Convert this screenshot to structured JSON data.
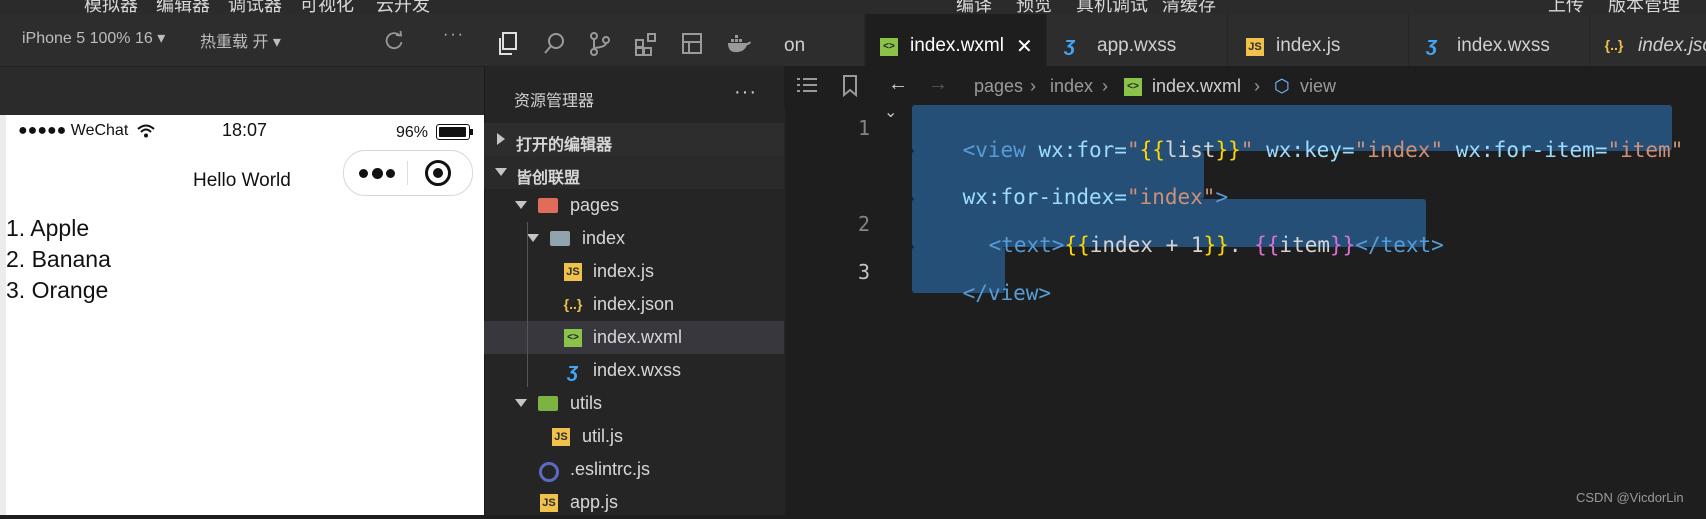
{
  "menu": [
    "模拟器",
    "编辑器",
    "调试器",
    "可视化",
    "云开发",
    "编译",
    "预览",
    "真机调试",
    "清缓存",
    "上传",
    "版本管理"
  ],
  "simulator": {
    "device": "iPhone 5 100% 16",
    "hotreload": "热重载 开",
    "status": {
      "signal": "●●●●● WeChat",
      "time": "18:07",
      "battery": "96%"
    },
    "nav_title": "Hello World",
    "list": [
      "1. Apple",
      "2. Banana",
      "3. Orange"
    ]
  },
  "explorer": {
    "title": "资源管理器",
    "more": "···",
    "open_editors": "打开的编辑器",
    "project": "皆创联盟",
    "files": {
      "pages": "pages",
      "index": "index",
      "index_js": "index.js",
      "index_json": "index.json",
      "index_wxml": "index.wxml",
      "index_wxss": "index.wxss",
      "utils": "utils",
      "util_js": "util.js",
      "eslintrc": ".eslintrc.js",
      "app_js": "app.js"
    }
  },
  "tabs": [
    {
      "label": "on"
    },
    {
      "label": "index.wxml",
      "active": true
    },
    {
      "label": "app.wxss"
    },
    {
      "label": "index.js"
    },
    {
      "label": "index.wxss"
    },
    {
      "label": "index.json"
    }
  ],
  "breadcrumb": [
    "pages",
    "index",
    "index.wxml",
    "view"
  ],
  "code": {
    "line_numbers": [
      "1",
      "2",
      "3"
    ],
    "l1a_open": "<view",
    "l1a_forattr": " wx:for=",
    "l1a_q1": "\"",
    "l1a_brace_open": "{{",
    "l1a_list": "list",
    "l1a_brace_close": "}}",
    "l1a_q2": "\"",
    "l1a_keyattr": " wx:key=",
    "l1a_keyval": "\"index\"",
    "l1a_itemattr": " wx:for-item=",
    "l1a_itemval": "\"item\"",
    "l1b_idxattr": "wx:for-index=",
    "l1b_idxval": "\"index\"",
    "l1b_gt": ">",
    "l2_text_open": "<text>",
    "l2_b1": "{{",
    "l2_expr": "index + 1",
    "l2_b2": "}}",
    "l2_dot": ". ",
    "l2_b3": "{{",
    "l2_item": "item",
    "l2_b4": "}}",
    "l2_text_close": "</text>",
    "l3_close": "</view>"
  },
  "watermark": "CSDN @VicdorLin",
  "colors": {
    "tag": "#569cd6",
    "attr": "#9cdcfe",
    "string": "#ce9178",
    "brace": "#ffd700",
    "var": "#d4d4d4",
    "highlight": "#264f78"
  }
}
